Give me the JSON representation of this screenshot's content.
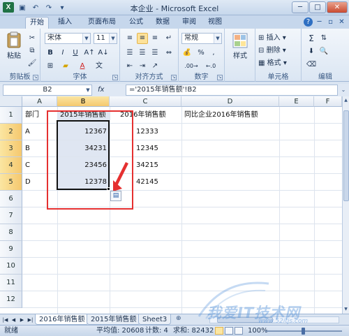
{
  "window": {
    "title": "本企业 - Microsoft Excel",
    "app_icon": "X",
    "controls": [
      "─",
      "□",
      "✕"
    ]
  },
  "ribbon": {
    "tabs": [
      "开始",
      "插入",
      "页面布局",
      "公式",
      "数据",
      "审阅",
      "视图"
    ],
    "active_tab": "开始",
    "groups": {
      "clipboard": {
        "name": "剪贴板",
        "paste": "粘贴"
      },
      "font": {
        "name": "字体",
        "font_name": "宋体",
        "font_size": "11",
        "style_buttons": [
          "B",
          "I",
          "U"
        ]
      },
      "alignment": {
        "name": "对齐方式"
      },
      "number": {
        "name": "数字",
        "format": "常规",
        "percent": "%",
        "comma": ",",
        "decimals": [
          ".00→",
          "←.0"
        ]
      },
      "styles": {
        "name": "样式",
        "label": "样式"
      },
      "cells": {
        "name": "单元格",
        "insert": "插入",
        "delete": "删除",
        "format": "格式"
      },
      "editing": {
        "name": "编辑",
        "sum": "Σ"
      }
    }
  },
  "formula_bar": {
    "name_box": "B2",
    "fx": "fx",
    "formula": "='2015年销售额'!B2"
  },
  "sheet": {
    "columns": [
      "A",
      "B",
      "C",
      "D",
      "E",
      "F"
    ],
    "selected_column": "B",
    "rows": [
      "1",
      "2",
      "3",
      "4",
      "5",
      "6",
      "7",
      "8",
      "9",
      "10",
      "11",
      "12"
    ],
    "selected_rows": [
      "2",
      "3",
      "4",
      "5"
    ],
    "cells": {
      "A1": "部门",
      "B1": "2015年销售额",
      "C1": "2016年销售额",
      "D1": "同比企业2016年销售额",
      "A2": "A",
      "B2": "12367",
      "C2": "12333",
      "A3": "B",
      "B3": "34231",
      "C3": "12345",
      "A4": "C",
      "B4": "23456",
      "C4": "34215",
      "A5": "D",
      "B5": "12378",
      "C5": "42145"
    },
    "paste_options_icon": "paste-options-icon"
  },
  "sheet_tabs": {
    "tabs": [
      "2016年销售额",
      "2015年销售额",
      "Sheet3"
    ],
    "active": "2016年销售额"
  },
  "status_bar": {
    "ready": "就绪",
    "average": "平均值: 20608",
    "count": "计数: 4",
    "sum": "求和: 82432",
    "zoom": "100%"
  },
  "watermark": {
    "text": "我爱IT技术网",
    "url": "www.52itjs.com"
  },
  "colors": {
    "selection_border": "#111111",
    "annotation": "#e53030",
    "header_selected": "#f5c86e",
    "ribbon_bg": "#dbe6f3"
  }
}
